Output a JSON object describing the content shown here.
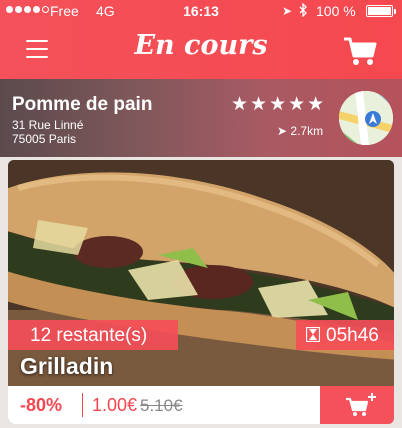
{
  "status_bar": {
    "carrier": "Free",
    "network": "4G",
    "time": "16:13",
    "battery": "100 %",
    "icons": [
      "signal-dots",
      "location-arrow-icon",
      "bluetooth-icon",
      "battery-icon"
    ]
  },
  "header": {
    "title": "En cours",
    "menu_icon": "hamburger-icon",
    "cart_icon": "cart-icon",
    "color": "#f4515a"
  },
  "shop": {
    "name": "Pomme de pain",
    "address_line1": "31 Rue Linné",
    "address_line2": "75005 Paris",
    "stars": "★★★★★",
    "rating": 5,
    "distance": "2.7km",
    "map_icon": "maps-icon"
  },
  "product": {
    "remaining": "12 restante(s)",
    "timer": "05h46",
    "name": "Grilladin",
    "discount": "-80%",
    "price": "1.00€",
    "old_price": "5.10€",
    "add_icon": "add-to-cart-icon",
    "accent": "#f2474f"
  }
}
